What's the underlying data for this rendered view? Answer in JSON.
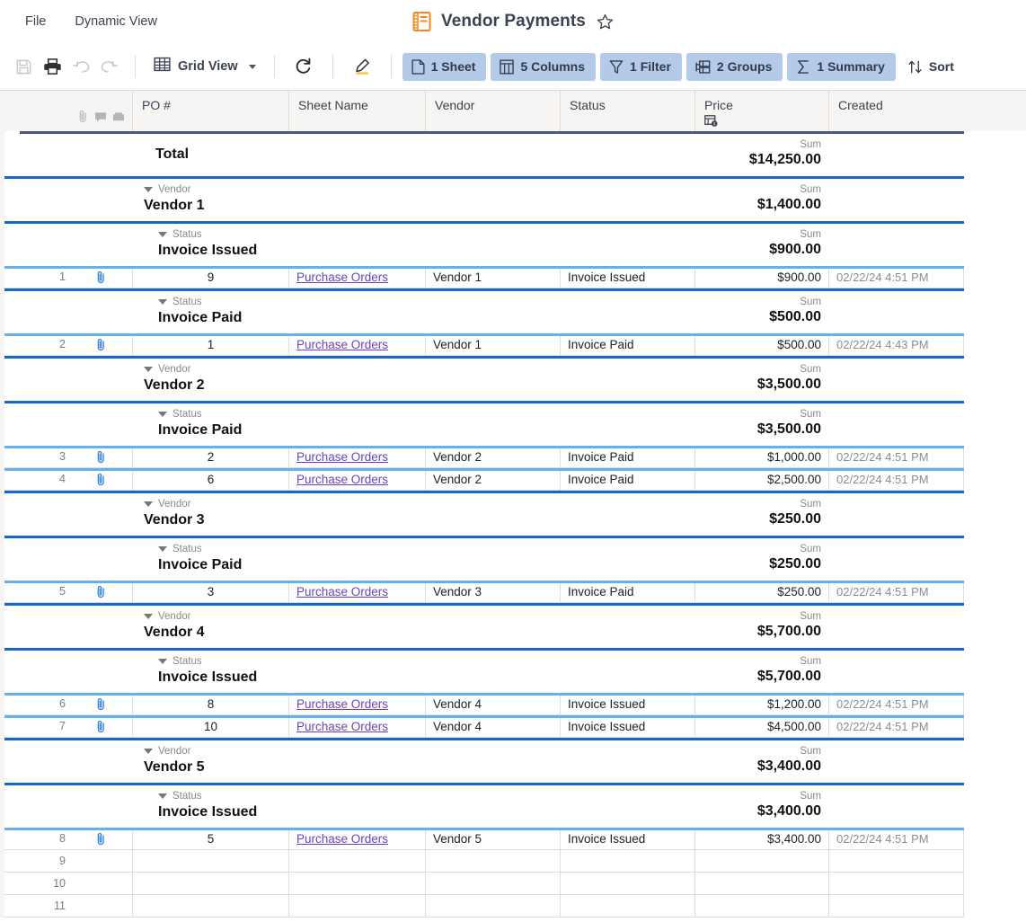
{
  "menubar": {
    "items": [
      {
        "label": "File"
      },
      {
        "label": "Dynamic View"
      }
    ],
    "title": "Vendor Payments",
    "title_icon": "sheet-icon",
    "favorite_icon": "star-icon"
  },
  "toolbar": {
    "icons": [
      {
        "name": "save-icon",
        "label": "Save"
      },
      {
        "name": "print-icon",
        "label": "Print"
      },
      {
        "name": "undo-icon",
        "label": "Undo"
      },
      {
        "name": "redo-icon",
        "label": "Redo"
      }
    ],
    "view_label": "Grid View",
    "refresh_label": "Refresh",
    "highlight_label": "Highlight Changes",
    "pills": [
      {
        "name": "sheet",
        "label": "1 Sheet",
        "icon": "sheet-page-icon",
        "active": true
      },
      {
        "name": "columns",
        "label": "5 Columns",
        "icon": "columns-icon",
        "active": true
      },
      {
        "name": "filter",
        "label": "1 Filter",
        "icon": "funnel-icon",
        "active": true
      },
      {
        "name": "groups",
        "label": "2 Groups",
        "icon": "group-icon",
        "active": true
      },
      {
        "name": "summary",
        "label": "1 Summary",
        "icon": "sigma-icon",
        "active": true
      },
      {
        "name": "sort",
        "label": "Sort",
        "icon": "sort-arrows-icon",
        "active": false
      }
    ],
    "accent_color": "#b3cbe8"
  },
  "grid": {
    "gutter_icons": [
      "attachment-icon",
      "comment-icon",
      "proof-icon"
    ],
    "columns": [
      {
        "key": "po",
        "label": "PO #"
      },
      {
        "key": "sheet",
        "label": "Sheet Name"
      },
      {
        "key": "vendor",
        "label": "Vendor"
      },
      {
        "key": "status",
        "label": "Status"
      },
      {
        "key": "price",
        "label": "Price",
        "sub_icon": "column-info-icon"
      },
      {
        "key": "created",
        "label": "Created"
      }
    ],
    "summary_word": "Sum",
    "total": {
      "label": "Total",
      "sum": "$14,250.00"
    },
    "rows": [
      {
        "type": "group",
        "level": 1,
        "kind": "Vendor",
        "name": "Vendor 1",
        "sum": "$1,400.00"
      },
      {
        "type": "group",
        "level": 2,
        "kind": "Status",
        "name": "Invoice Issued",
        "sum": "$900.00"
      },
      {
        "type": "data",
        "n": "1",
        "po": "9",
        "sheet": "Purchase Orders",
        "vendor": "Vendor 1",
        "status": "Invoice Issued",
        "price": "$900.00",
        "created": "02/22/24 4:51 PM",
        "attachment": true
      },
      {
        "type": "group",
        "level": 2,
        "kind": "Status",
        "name": "Invoice Paid",
        "sum": "$500.00"
      },
      {
        "type": "data",
        "n": "2",
        "po": "1",
        "sheet": "Purchase Orders",
        "vendor": "Vendor 1",
        "status": "Invoice Paid",
        "price": "$500.00",
        "created": "02/22/24 4:43 PM",
        "attachment": true
      },
      {
        "type": "group",
        "level": 1,
        "kind": "Vendor",
        "name": "Vendor 2",
        "sum": "$3,500.00"
      },
      {
        "type": "group",
        "level": 2,
        "kind": "Status",
        "name": "Invoice Paid",
        "sum": "$3,500.00"
      },
      {
        "type": "data",
        "n": "3",
        "po": "2",
        "sheet": "Purchase Orders",
        "vendor": "Vendor 2",
        "status": "Invoice Paid",
        "price": "$1,000.00",
        "created": "02/22/24 4:51 PM",
        "attachment": true
      },
      {
        "type": "data",
        "n": "4",
        "po": "6",
        "sheet": "Purchase Orders",
        "vendor": "Vendor 2",
        "status": "Invoice Paid",
        "price": "$2,500.00",
        "created": "02/22/24 4:51 PM",
        "attachment": true
      },
      {
        "type": "group",
        "level": 1,
        "kind": "Vendor",
        "name": "Vendor 3",
        "sum": "$250.00"
      },
      {
        "type": "group",
        "level": 2,
        "kind": "Status",
        "name": "Invoice Paid",
        "sum": "$250.00"
      },
      {
        "type": "data",
        "n": "5",
        "po": "3",
        "sheet": "Purchase Orders",
        "vendor": "Vendor 3",
        "status": "Invoice Paid",
        "price": "$250.00",
        "created": "02/22/24 4:51 PM",
        "attachment": true
      },
      {
        "type": "group",
        "level": 1,
        "kind": "Vendor",
        "name": "Vendor 4",
        "sum": "$5,700.00"
      },
      {
        "type": "group",
        "level": 2,
        "kind": "Status",
        "name": "Invoice Issued",
        "sum": "$5,700.00"
      },
      {
        "type": "data",
        "n": "6",
        "po": "8",
        "sheet": "Purchase Orders",
        "vendor": "Vendor 4",
        "status": "Invoice Issued",
        "price": "$1,200.00",
        "created": "02/22/24 4:51 PM",
        "attachment": true
      },
      {
        "type": "data",
        "n": "7",
        "po": "10",
        "sheet": "Purchase Orders",
        "vendor": "Vendor 4",
        "status": "Invoice Issued",
        "price": "$4,500.00",
        "created": "02/22/24 4:51 PM",
        "attachment": true
      },
      {
        "type": "group",
        "level": 1,
        "kind": "Vendor",
        "name": "Vendor 5",
        "sum": "$3,400.00"
      },
      {
        "type": "group",
        "level": 2,
        "kind": "Status",
        "name": "Invoice Issued",
        "sum": "$3,400.00"
      },
      {
        "type": "data",
        "n": "8",
        "po": "5",
        "sheet": "Purchase Orders",
        "vendor": "Vendor 5",
        "status": "Invoice Issued",
        "price": "$3,400.00",
        "created": "02/22/24 4:51 PM",
        "attachment": true
      },
      {
        "type": "blank",
        "n": "9"
      },
      {
        "type": "blank",
        "n": "10"
      },
      {
        "type": "blank",
        "n": "11"
      }
    ],
    "colors": {
      "total_rule": "#4a5689",
      "group_rule": "#1567c8",
      "data_rule": "#62b0f0",
      "link": "#6a42c1",
      "header_bg": "#f6f5f3"
    }
  }
}
